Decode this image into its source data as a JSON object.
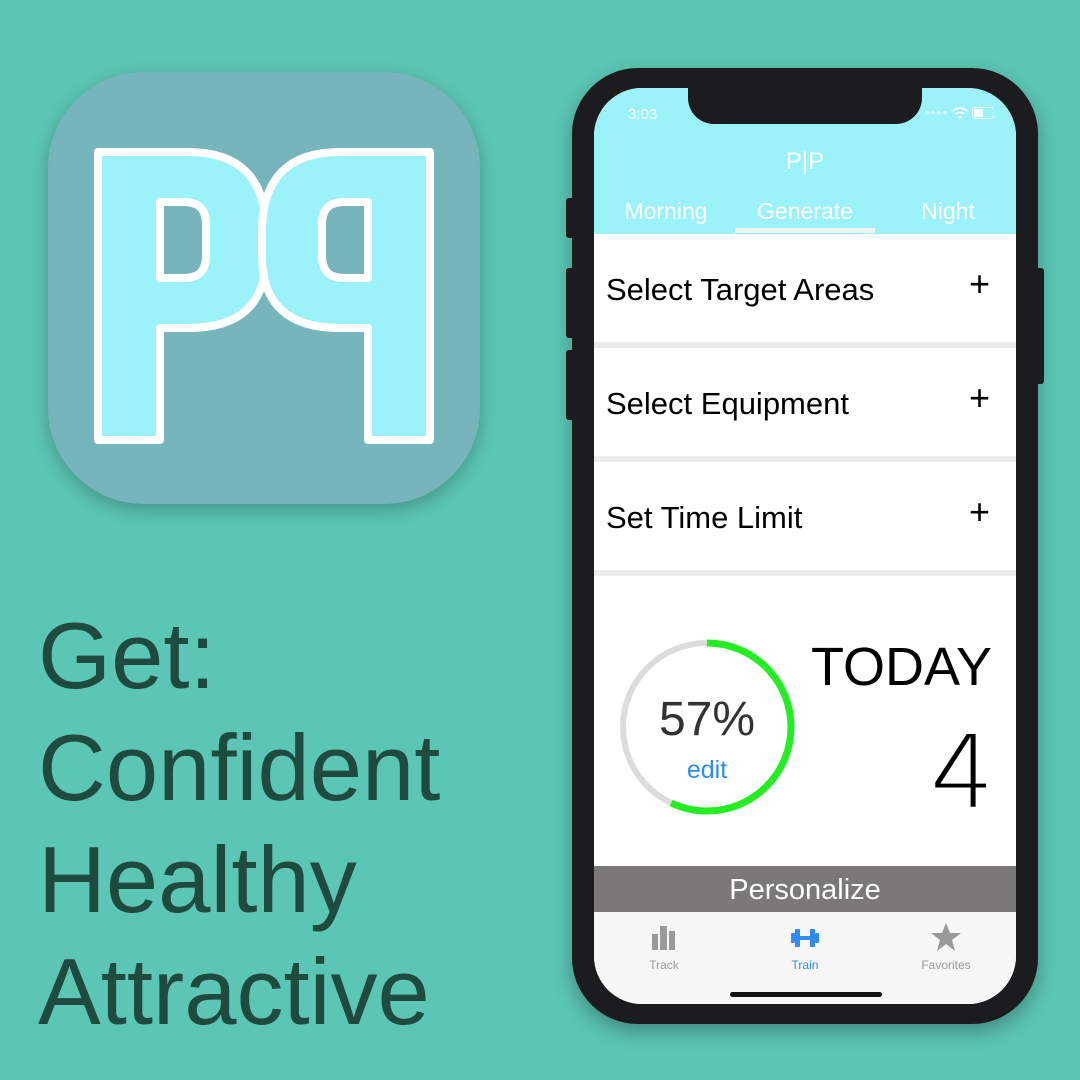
{
  "app_icon": {
    "letters": "PP",
    "background": "#76b5bc",
    "letter_color": "#9cf2fb"
  },
  "tagline": {
    "line1": "Get:",
    "line2": "Confident",
    "line3": "Healthy",
    "line4": "Attractive"
  },
  "status_bar": {
    "time": "3:03",
    "icons": [
      "signal-dots-icon",
      "wifi-icon",
      "battery-icon"
    ]
  },
  "header": {
    "title": "P|P",
    "tabs": [
      {
        "label": "Morning",
        "active": false
      },
      {
        "label": "Generate",
        "active": true
      },
      {
        "label": "Night",
        "active": false
      }
    ]
  },
  "rows": [
    {
      "label": "Select Target Areas",
      "action": "+"
    },
    {
      "label": "Select Equipment",
      "action": "+"
    },
    {
      "label": "Set Time Limit",
      "action": "+"
    }
  ],
  "progress": {
    "percent_label": "57%",
    "fraction": 0.57,
    "edit_label": "edit",
    "ring_color": "#22ee22",
    "track_color": "#dcdcdc"
  },
  "today": {
    "label": "TODAY",
    "count": "4"
  },
  "personalize_label": "Personalize",
  "tab_bar": [
    {
      "label": "Track",
      "icon": "bar-chart-icon",
      "active": false
    },
    {
      "label": "Train",
      "icon": "dumbbell-icon",
      "active": true
    },
    {
      "label": "Favorites",
      "icon": "star-icon",
      "active": false
    }
  ],
  "colors": {
    "background": "#5cc6b4",
    "header": "#9cf2fb",
    "accent_blue": "#2f8cf5",
    "personalize_bar": "#7a7878"
  }
}
